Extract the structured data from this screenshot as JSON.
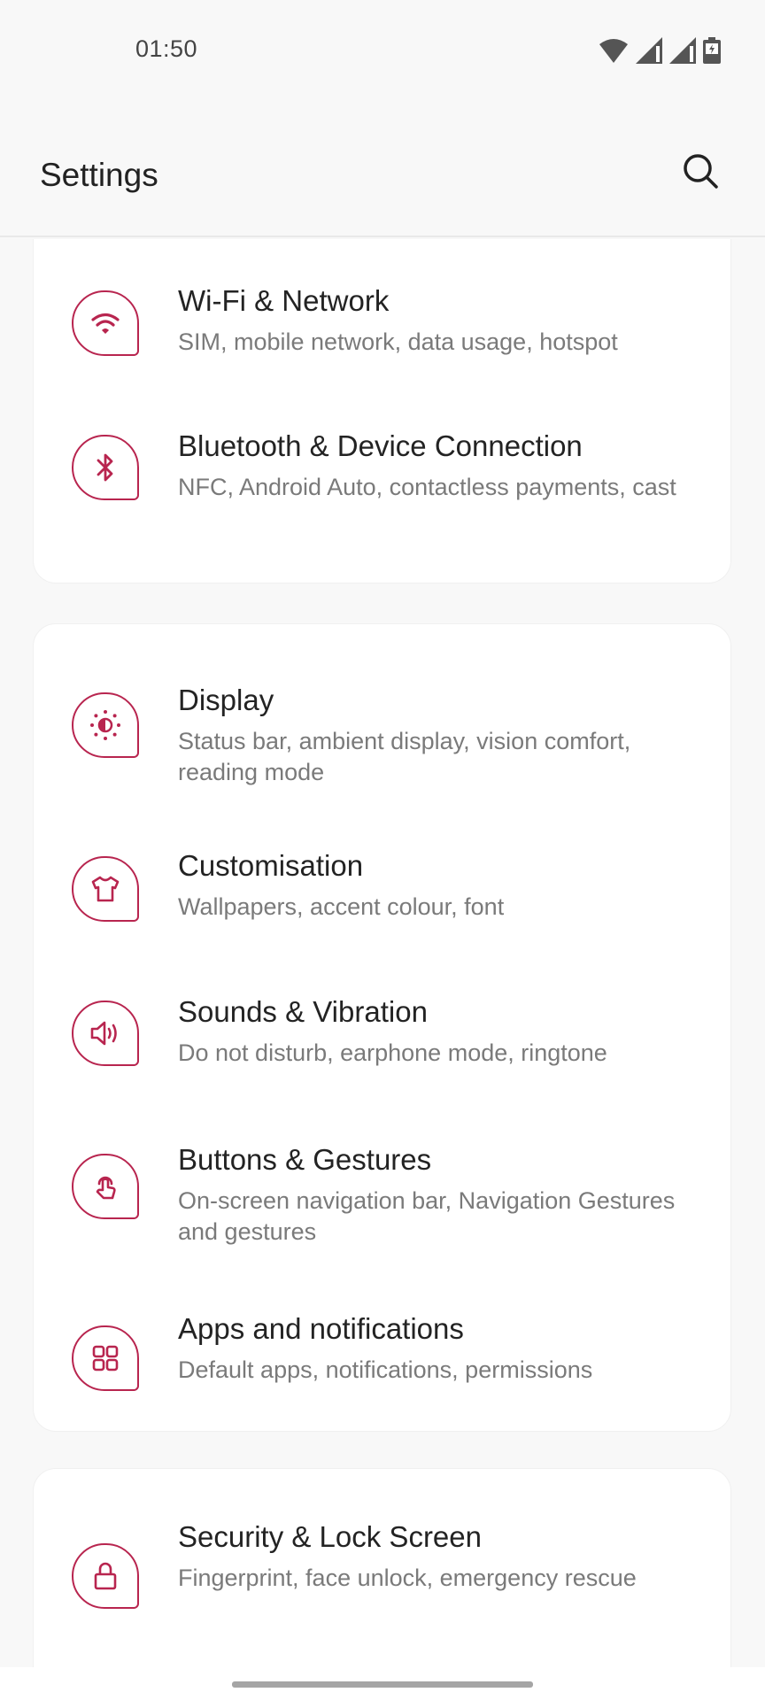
{
  "status_bar": {
    "time": "01:50",
    "icons": [
      "wifi-icon",
      "cell-signal-icon",
      "cell-signal-icon",
      "battery-charging-icon"
    ]
  },
  "header": {
    "title": "Settings",
    "search_icon": "search-icon"
  },
  "colors": {
    "accent": "#b8254f",
    "background": "#f8f8f8",
    "card": "#ffffff",
    "title_text": "#232323",
    "subtitle_text": "#7a7a7a"
  },
  "groups": [
    {
      "items": [
        {
          "title": "Wi-Fi & Network",
          "subtitle": "SIM, mobile network, data usage, hotspot",
          "icon": "wifi-icon"
        },
        {
          "title": "Bluetooth & Device Connection",
          "subtitle": "NFC, Android Auto, contactless payments, cast",
          "icon": "bluetooth-icon"
        }
      ]
    },
    {
      "items": [
        {
          "title": "Display",
          "subtitle": "Status bar, ambient display, vision comfort, reading mode",
          "icon": "brightness-icon"
        },
        {
          "title": "Customisation",
          "subtitle": "Wallpapers, accent colour, font",
          "icon": "tshirt-icon"
        },
        {
          "title": "Sounds & Vibration",
          "subtitle": "Do not disturb, earphone mode, ringtone",
          "icon": "speaker-icon"
        },
        {
          "title": "Buttons & Gestures",
          "subtitle": "On-screen navigation bar, Navigation Gestures and gestures",
          "icon": "touch-gesture-icon"
        },
        {
          "title": "Apps and notifications",
          "subtitle": "Default apps, notifications, permissions",
          "icon": "apps-grid-icon"
        }
      ]
    },
    {
      "items": [
        {
          "title": "Security & Lock Screen",
          "subtitle": "Fingerprint, face unlock, emergency rescue",
          "icon": "lock-icon"
        }
      ]
    }
  ]
}
